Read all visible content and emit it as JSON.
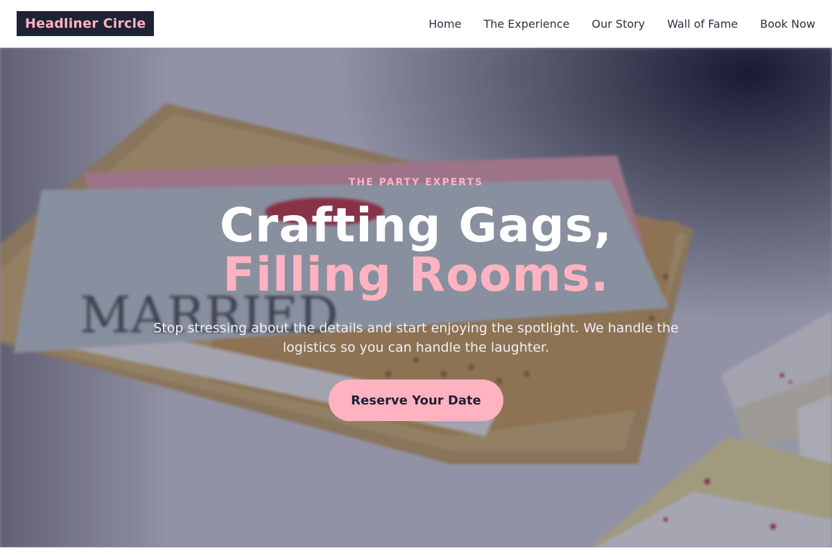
{
  "header": {
    "logo_text": "Headliner Circle",
    "nav": [
      {
        "label": "Home"
      },
      {
        "label": "The Experience"
      },
      {
        "label": "Our Story"
      },
      {
        "label": "Wall of Fame"
      },
      {
        "label": "Book Now"
      }
    ]
  },
  "hero": {
    "eyebrow": "THE PARTY EXPERTS",
    "headline_line1": "Crafting Gags,",
    "headline_line2": "Filling Rooms.",
    "subtitle": "Stop stressing about the details and start enjoying the spotlight. We handle the logistics so you can handle the laughter.",
    "cta_label": "Reserve Your Date",
    "background_card_text": "MARRIED"
  },
  "colors": {
    "accent_pink": "#ffb3c1",
    "navy": "#1e2235",
    "nav_text": "#2b2f3f"
  }
}
